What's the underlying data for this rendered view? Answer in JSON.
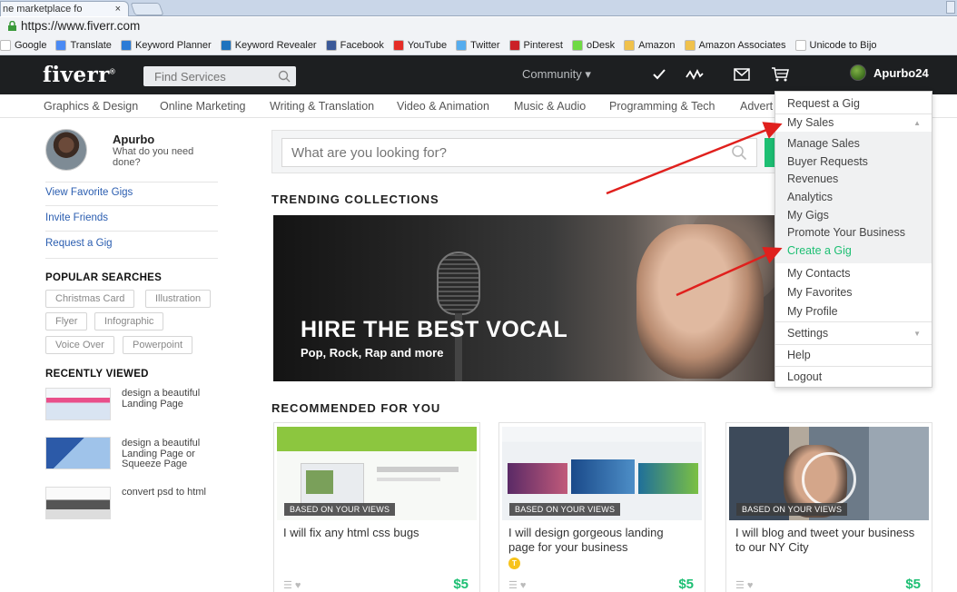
{
  "browser": {
    "tab_title": "ne marketplace fo",
    "tab_close": "×",
    "url": "https://www.fiverr.com",
    "bookmarks": [
      {
        "label": "Google",
        "color": "#ffffff"
      },
      {
        "label": "Translate",
        "color": "#4a8af4"
      },
      {
        "label": "Keyword Planner",
        "color": "#2b7bd6"
      },
      {
        "label": "Keyword Revealer",
        "color": "#1e73be"
      },
      {
        "label": "Facebook",
        "color": "#3b5998"
      },
      {
        "label": "YouTube",
        "color": "#e52d27"
      },
      {
        "label": "Twitter",
        "color": "#55acee"
      },
      {
        "label": "Pinterest",
        "color": "#cb2027"
      },
      {
        "label": "oDesk",
        "color": "#6fda44"
      },
      {
        "label": "Amazon",
        "color": "#f0c14b"
      },
      {
        "label": "Amazon Associates",
        "color": "#f0c14b"
      },
      {
        "label": "Unicode to Bijo",
        "color": "#ffffff"
      }
    ]
  },
  "header": {
    "logo": "fiverr",
    "logo_mark": "®",
    "search_placeholder": "Find Services",
    "community": "Community ▾",
    "username": "Apurbo24"
  },
  "categories": [
    "Graphics & Design",
    "Online Marketing",
    "Writing & Translation",
    "Video & Animation",
    "Music & Audio",
    "Programming & Tech",
    "Advert"
  ],
  "sidebar": {
    "name": "Apurbo",
    "prompt": "What do you need done?",
    "links": [
      "View Favorite Gigs",
      "Invite Friends",
      "Request a Gig"
    ],
    "popular_heading": "POPULAR SEARCHES",
    "tags": [
      "Christmas Card",
      "Illustration",
      "Flyer",
      "Infographic",
      "Voice Over",
      "Powerpoint"
    ],
    "recent_heading": "RECENTLY VIEWED",
    "recent": [
      "design a beautiful Landing Page",
      "design a beautiful Landing Page or Squeeze Page",
      "convert psd to html"
    ]
  },
  "main": {
    "search_placeholder": "What are you looking for?",
    "trending_heading": "TRENDING COLLECTIONS",
    "hero_title": "HIRE THE BEST VOCAL",
    "hero_sub": "Pop, Rock, Rap and more",
    "recommended_heading": "RECOMMENDED FOR YOU",
    "cards": [
      {
        "badge": "BASED ON YOUR VIEWS",
        "title": "I will fix any html css bugs",
        "price": "$5"
      },
      {
        "badge": "BASED ON YOUR VIEWS",
        "title": "I will design gorgeous landing page for your business",
        "price": "$5",
        "level": "T"
      },
      {
        "badge": "BASED ON YOUR VIEWS",
        "title": "I will blog and tweet your business to our NY City",
        "price": "$5"
      }
    ]
  },
  "dropdown": {
    "request_gig": "Request a Gig",
    "my_sales": "My Sales",
    "sub": [
      "Manage Sales",
      "Buyer Requests",
      "Revenues",
      "Analytics",
      "My Gigs",
      "Promote Your Business",
      "Create a Gig"
    ],
    "items": [
      "My Contacts",
      "My Favorites",
      "My Profile"
    ],
    "settings": "Settings",
    "help": "Help",
    "logout": "Logout"
  },
  "colors": {
    "green": "#1dbf73",
    "header_bg": "#1d1f21",
    "link": "#2a5db0",
    "arrow": "#e0201d"
  }
}
